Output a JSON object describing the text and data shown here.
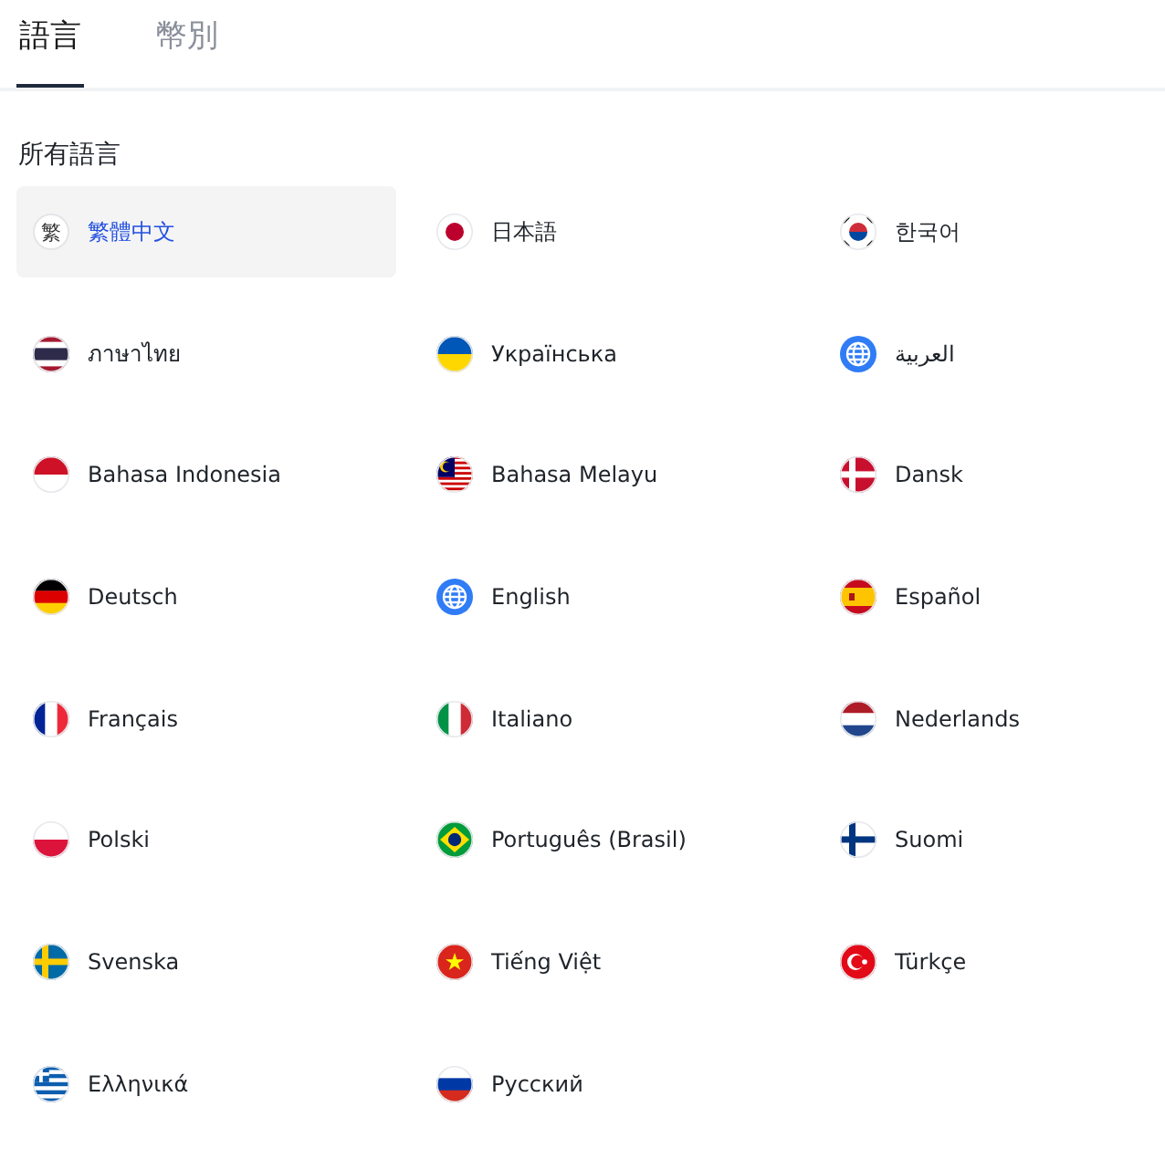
{
  "tabs": [
    {
      "label": "語言",
      "selected": true
    },
    {
      "label": "幣別",
      "selected": false
    }
  ],
  "section_title": "所有語言",
  "languages": [
    {
      "label": "繁體中文",
      "kind": "badge",
      "badge": "繁",
      "selected": true
    },
    {
      "label": "日本語",
      "kind": "japan",
      "selected": false
    },
    {
      "label": "한국어",
      "kind": "korea",
      "selected": false
    },
    {
      "label": "ภาษาไทย",
      "kind": "thailand",
      "selected": false
    },
    {
      "label": "Українська",
      "kind": "ukraine",
      "selected": false
    },
    {
      "label": "العربية",
      "kind": "globe",
      "selected": false
    },
    {
      "label": "Bahasa Indonesia",
      "kind": "indonesia",
      "selected": false
    },
    {
      "label": "Bahasa Melayu",
      "kind": "malaysia",
      "selected": false
    },
    {
      "label": "Dansk",
      "kind": "denmark",
      "selected": false
    },
    {
      "label": "Deutsch",
      "kind": "germany",
      "selected": false
    },
    {
      "label": "English",
      "kind": "globe",
      "selected": false
    },
    {
      "label": "Español",
      "kind": "spain",
      "selected": false
    },
    {
      "label": "Français",
      "kind": "france",
      "selected": false
    },
    {
      "label": "Italiano",
      "kind": "italy",
      "selected": false
    },
    {
      "label": "Nederlands",
      "kind": "netherlands",
      "selected": false
    },
    {
      "label": "Polski",
      "kind": "poland",
      "selected": false
    },
    {
      "label": "Português (Brasil)",
      "kind": "brazil",
      "selected": false
    },
    {
      "label": "Suomi",
      "kind": "finland",
      "selected": false
    },
    {
      "label": "Svenska",
      "kind": "sweden",
      "selected": false
    },
    {
      "label": "Tiếng Việt",
      "kind": "vietnam",
      "selected": false
    },
    {
      "label": "Türkçe",
      "kind": "turkey",
      "selected": false
    },
    {
      "label": "Ελληνικά",
      "kind": "greece",
      "selected": false
    },
    {
      "label": "Русский",
      "kind": "russia",
      "selected": false
    }
  ]
}
